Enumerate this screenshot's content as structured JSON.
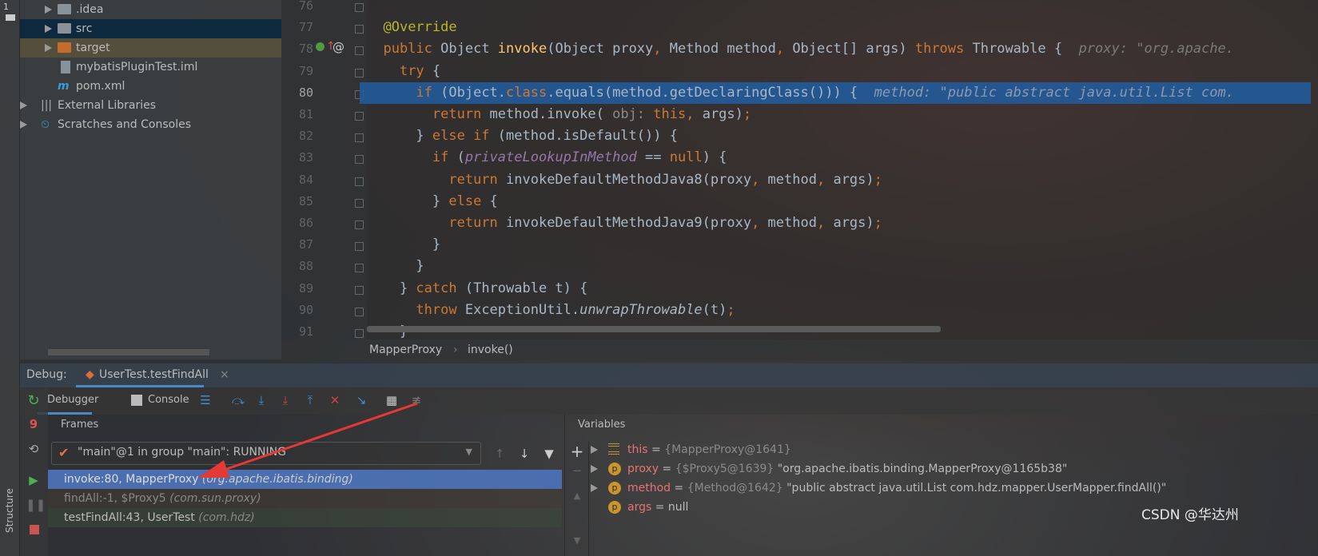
{
  "project_tree": {
    "items": [
      {
        "label": ".idea",
        "type": "folder",
        "expandable": true
      },
      {
        "label": "src",
        "type": "folder",
        "expandable": true,
        "selected": true
      },
      {
        "label": "target",
        "type": "folder-excluded",
        "expandable": true
      },
      {
        "label": "mybatisPluginTest.iml",
        "type": "iml-file"
      },
      {
        "label": "pom.xml",
        "type": "maven-file"
      },
      {
        "label": "External Libraries",
        "type": "libraries",
        "expandable": true
      },
      {
        "label": "Scratches and Consoles",
        "type": "scratches",
        "expandable": true
      }
    ],
    "stripe_label": "1"
  },
  "editor": {
    "current_line": 80,
    "lines": [
      {
        "n": "76",
        "seg": []
      },
      {
        "n": "77",
        "seg": [
          [
            "  ",
            ""
          ],
          [
            "@Override",
            "an"
          ]
        ]
      },
      {
        "n": "78",
        "seg": [
          [
            "  ",
            ""
          ],
          [
            "public ",
            "kw"
          ],
          [
            "Object ",
            ""
          ],
          [
            "invoke",
            "md"
          ],
          [
            "(Object proxy",
            ""
          ],
          [
            ", ",
            "kw"
          ],
          [
            "Method method",
            ""
          ],
          [
            ", ",
            "kw"
          ],
          [
            "Object[] args) ",
            ""
          ],
          [
            "throws ",
            "kw"
          ],
          [
            "Throwable {  ",
            ""
          ],
          [
            "proxy: \"org.apache.",
            "hint"
          ]
        ]
      },
      {
        "n": "79",
        "seg": [
          [
            "    ",
            ""
          ],
          [
            "try ",
            "kw"
          ],
          [
            "{",
            ""
          ]
        ]
      },
      {
        "n": "80",
        "seg": [
          [
            "      ",
            ""
          ],
          [
            "if ",
            "kw"
          ],
          [
            "(Object.",
            ""
          ],
          [
            "class",
            "kw"
          ],
          [
            ".equals(method.getDeclaringClass())) {  ",
            ""
          ],
          [
            "method: \"public abstract java.util.List com.",
            "hint2"
          ]
        ]
      },
      {
        "n": "81",
        "seg": [
          [
            "        ",
            ""
          ],
          [
            "return ",
            "kw"
          ],
          [
            "method.invoke( ",
            ""
          ],
          [
            "obj: ",
            "ph"
          ],
          [
            "this",
            "kw"
          ],
          [
            ", ",
            "kw"
          ],
          [
            "args)",
            ""
          ],
          [
            ";",
            "kw"
          ]
        ]
      },
      {
        "n": "82",
        "seg": [
          [
            "      } ",
            ""
          ],
          [
            "else if ",
            "kw"
          ],
          [
            "(method.isDefault()) {",
            ""
          ]
        ]
      },
      {
        "n": "83",
        "seg": [
          [
            "        ",
            ""
          ],
          [
            "if ",
            "kw"
          ],
          [
            "(",
            ""
          ],
          [
            "privateLookupInMethod",
            "fd"
          ],
          [
            " == ",
            ""
          ],
          [
            "null",
            "kw"
          ],
          [
            ") {",
            ""
          ]
        ]
      },
      {
        "n": "84",
        "seg": [
          [
            "          ",
            ""
          ],
          [
            "return ",
            "kw"
          ],
          [
            "invokeDefaultMethodJava8(proxy",
            ""
          ],
          [
            ", ",
            "kw"
          ],
          [
            "method",
            ""
          ],
          [
            ", ",
            "kw"
          ],
          [
            "args)",
            ""
          ],
          [
            ";",
            "kw"
          ]
        ]
      },
      {
        "n": "85",
        "seg": [
          [
            "        } ",
            ""
          ],
          [
            "else ",
            "kw"
          ],
          [
            "{",
            ""
          ]
        ]
      },
      {
        "n": "86",
        "seg": [
          [
            "          ",
            ""
          ],
          [
            "return ",
            "kw"
          ],
          [
            "invokeDefaultMethodJava9(proxy",
            ""
          ],
          [
            ", ",
            "kw"
          ],
          [
            "method",
            ""
          ],
          [
            ", ",
            "kw"
          ],
          [
            "args)",
            ""
          ],
          [
            ";",
            "kw"
          ]
        ]
      },
      {
        "n": "87",
        "seg": [
          [
            "        }",
            ""
          ]
        ]
      },
      {
        "n": "88",
        "seg": [
          [
            "      }",
            ""
          ]
        ]
      },
      {
        "n": "89",
        "seg": [
          [
            "    } ",
            ""
          ],
          [
            "catch ",
            "kw"
          ],
          [
            "(Throwable t) {",
            ""
          ]
        ]
      },
      {
        "n": "90",
        "seg": [
          [
            "      ",
            ""
          ],
          [
            "throw ",
            "kw"
          ],
          [
            "ExceptionUtil.",
            ""
          ],
          [
            "unwrapThrowable",
            "st"
          ],
          [
            "(t)",
            ""
          ],
          [
            ";",
            "kw"
          ]
        ]
      },
      {
        "n": "91",
        "seg": [
          [
            "    }",
            ""
          ]
        ]
      }
    ]
  },
  "breadcrumb": {
    "class": "MapperProxy",
    "sep": "›",
    "method": "invoke()"
  },
  "debug": {
    "label": "Debug:",
    "session_tab": "UserTest.testFindAll",
    "close": "×",
    "tabs": {
      "debugger": "Debugger",
      "console": "Console"
    },
    "frames_title": "Frames",
    "variables_title": "Variables",
    "thread": "\"main\"@1 in group \"main\": RUNNING",
    "frames": [
      {
        "method": "invoke:80, MapperProxy",
        "pkg": "(org.apache.ibatis.binding)",
        "selected": true
      },
      {
        "method": "findAll:-1, $Proxy5",
        "pkg": "(com.sun.proxy)",
        "dim": true
      },
      {
        "method": "testFindAll:43, UserTest",
        "pkg": "(com.hdz)"
      }
    ],
    "variables": [
      {
        "name": "this",
        "eq": " = ",
        "type": "{MapperProxy@1641}",
        "value": "",
        "icon": "field-icon"
      },
      {
        "name": "proxy",
        "eq": " = ",
        "type": "{$Proxy5@1639}",
        "value": " \"org.apache.ibatis.binding.MapperProxy@1165b38\"",
        "icon": "p"
      },
      {
        "name": "method",
        "eq": " = ",
        "type": "{Method@1642}",
        "value": " \"public abstract java.util.List com.hdz.mapper.UserMapper.findAll()\"",
        "icon": "p"
      },
      {
        "name": "args",
        "eq": " = ",
        "type": "",
        "value": "null",
        "icon": "p"
      }
    ],
    "structure_label": "Structure"
  },
  "watermark": "CSDN @华达州",
  "colors": {
    "selection": "#215da0",
    "keyword": "#cc7832",
    "arrow": "#e53935"
  }
}
